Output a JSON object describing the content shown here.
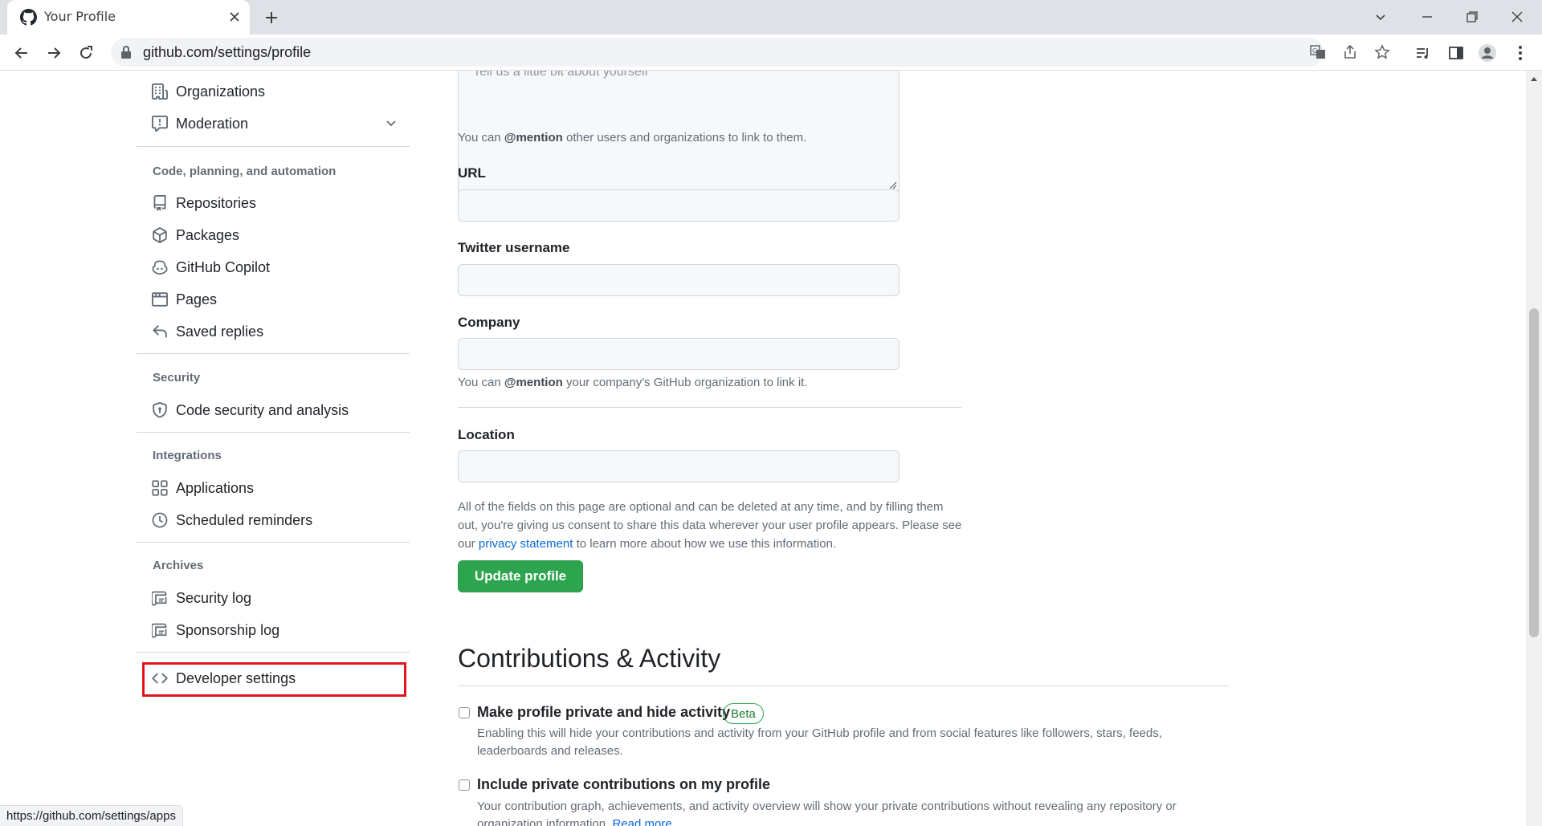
{
  "browser": {
    "tab_title": "Your Profile",
    "url": "github.com/settings/profile",
    "status_url": "https://github.com/settings/apps"
  },
  "sidebar": {
    "items_top": [
      {
        "label": "Organizations",
        "icon": "organization-icon"
      },
      {
        "label": "Moderation",
        "icon": "report-icon"
      }
    ],
    "code_heading": "Code, planning, and automation",
    "code_items": [
      {
        "label": "Repositories",
        "icon": "repo-icon"
      },
      {
        "label": "Packages",
        "icon": "package-icon"
      },
      {
        "label": "GitHub Copilot",
        "icon": "copilot-icon"
      },
      {
        "label": "Pages",
        "icon": "browser-icon"
      },
      {
        "label": "Saved replies",
        "icon": "reply-icon"
      }
    ],
    "security_heading": "Security",
    "security_items": [
      {
        "label": "Code security and analysis",
        "icon": "shield-icon"
      }
    ],
    "integrations_heading": "Integrations",
    "integrations_items": [
      {
        "label": "Applications",
        "icon": "apps-icon"
      },
      {
        "label": "Scheduled reminders",
        "icon": "clock-icon"
      }
    ],
    "archives_heading": "Archives",
    "archives_items": [
      {
        "label": "Security log",
        "icon": "log-icon"
      },
      {
        "label": "Sponsorship log",
        "icon": "log-icon"
      }
    ],
    "developer": {
      "label": "Developer settings",
      "icon": "code-icon"
    }
  },
  "form": {
    "bio_placeholder": "Tell us a little bit about yourself",
    "bio_note_pre": "You can ",
    "bio_note_mention": "@mention",
    "bio_note_post": " other users and organizations to link to them.",
    "url_label": "URL",
    "url_value": "",
    "twitter_label": "Twitter username",
    "twitter_value": "",
    "company_label": "Company",
    "company_value": "",
    "company_note_pre": "You can ",
    "company_note_mention": "@mention",
    "company_note_post": " your company's GitHub organization to link it.",
    "location_label": "Location",
    "location_value": "",
    "disclaimer_pre": "All of the fields on this page are optional and can be deleted at any time, and by filling them out, you're giving us consent to share this data wherever your user profile appears. Please see our ",
    "disclaimer_link": "privacy statement",
    "disclaimer_post": " to learn more about how we use this information.",
    "update_button": "Update profile"
  },
  "contributions": {
    "title": "Contributions & Activity",
    "private_label": "Make profile private and hide activity",
    "private_checked": false,
    "beta_badge": "Beta",
    "private_desc": "Enabling this will hide your contributions and activity from your GitHub profile and from social features like followers, stars, feeds, leaderboards and releases.",
    "include_label": "Include private contributions on my profile",
    "include_checked": false,
    "include_desc_pre": "Your contribution graph, achievements, and activity overview will show your private contributions without revealing any repository or organization information. ",
    "include_desc_link": "Read more"
  },
  "colors": {
    "accent_green": "#2da44e",
    "link_blue": "#0969da",
    "highlight_red": "#e0161d"
  }
}
